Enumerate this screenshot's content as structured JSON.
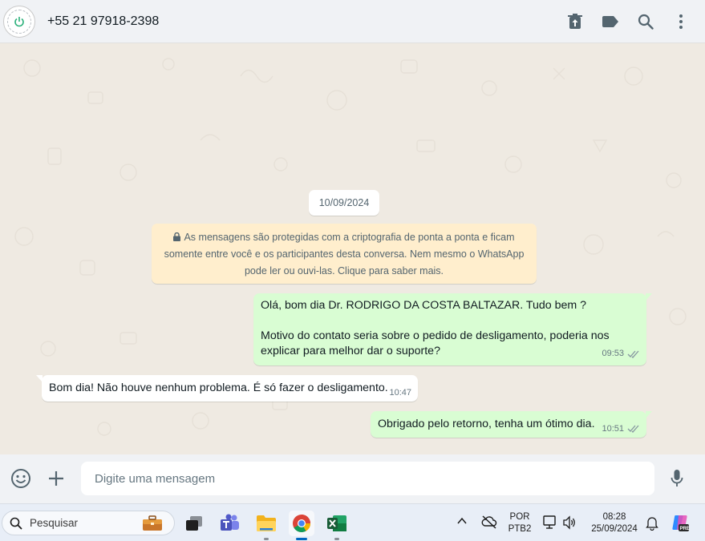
{
  "header": {
    "contact_name": "+55 21 97918-2398",
    "icons": [
      "power-icon",
      "delete-icon",
      "label-icon",
      "search-icon",
      "menu-icon"
    ]
  },
  "chat": {
    "date_chip": "10/09/2024",
    "encryption_notice": {
      "lines": [
        "As mensagens são protegidas com a criptografia de ponta a ponta e ficam",
        "somente entre você e os participantes desta conversa. Nem mesmo o WhatsApp",
        "pode ler ou ouvi-las. Clique para saber mais."
      ]
    },
    "messages": [
      {
        "direction": "outgoing",
        "lines": [
          "Olá, bom dia Dr. RODRIGO DA COSTA BALTAZAR. Tudo bem ?",
          "",
          "Motivo do contato seria sobre o pedido de desligamento, poderia nos",
          "explicar para melhor dar o suporte?"
        ],
        "time": "09:53"
      },
      {
        "direction": "incoming",
        "text": "Bom dia! Não houve nenhum problema. É só fazer o desligamento.",
        "time": "10:47"
      },
      {
        "direction": "outgoing",
        "text": "Obrigado pelo retorno, tenha um ótimo dia.",
        "time": "10:51"
      }
    ]
  },
  "composer": {
    "placeholder": "Digite uma mensagem"
  },
  "taskbar": {
    "search_label": "Pesquisar",
    "language_top": "POR",
    "language_bottom": "PTB2",
    "time": "08:28",
    "date": "25/09/2024",
    "colors": {
      "accent": "#0067c0",
      "whatsapp_out": "#d9fdd3",
      "whatsapp_bg": "#efeae2"
    }
  }
}
